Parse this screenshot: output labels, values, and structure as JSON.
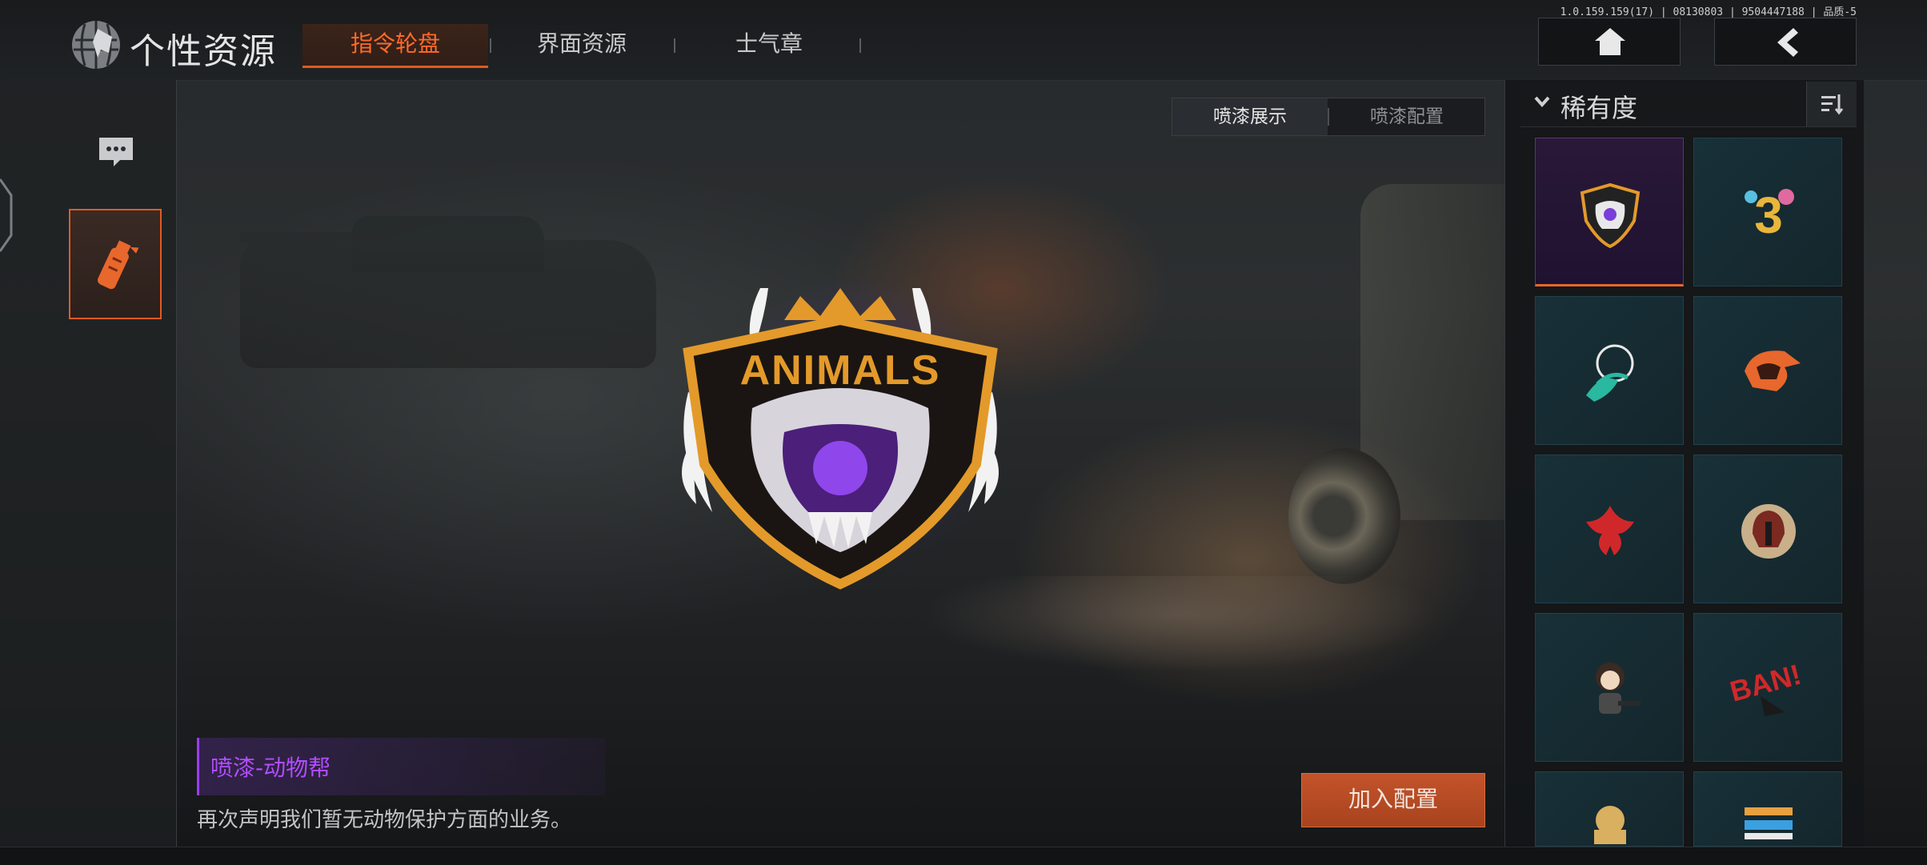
{
  "app": {
    "title": "个性资源",
    "version": "1.0.159.159(17) | 08130803 | 9504447188 | 品质-5"
  },
  "tabs": [
    {
      "label": "指令轮盘",
      "active": true
    },
    {
      "label": "界面资源",
      "active": false
    },
    {
      "label": "士气章",
      "active": false
    }
  ],
  "top_buttons": [
    {
      "icon": "home-icon"
    },
    {
      "icon": "back-arrow-icon"
    }
  ],
  "sidebar": {
    "items": [
      {
        "icon": "chat-bubble-icon",
        "selected": false
      },
      {
        "icon": "spray-grenade-icon",
        "selected": true
      }
    ]
  },
  "view_toggle": {
    "options": [
      "喷漆展示",
      "喷漆配置"
    ],
    "selected": "喷漆展示"
  },
  "selected_item": {
    "name": "喷漆-动物帮",
    "description": "再次声明我们暂无动物保护方面的业务。",
    "emblem_text": "ANIMALS"
  },
  "actions": {
    "add_label": "加入配置"
  },
  "filter": {
    "label": "稀有度",
    "sort_icon": "sort-icon"
  },
  "grid": [
    {
      "icon": "animals-emblem-icon",
      "selected": true
    },
    {
      "icon": "number-three-balloon-icon",
      "selected": false
    },
    {
      "icon": "wraiths-outlaws-icon",
      "selected": false
    },
    {
      "icon": "flaming-helmet-icon",
      "selected": false
    },
    {
      "icon": "red-phoenix-icon",
      "selected": false
    },
    {
      "icon": "spartan-helmet-icon",
      "selected": false
    },
    {
      "icon": "chibi-soldier-icon",
      "selected": false
    },
    {
      "icon": "bang-graffiti-icon",
      "selected": false
    },
    {
      "icon": "golden-figure-icon",
      "selected": false
    },
    {
      "icon": "pixel-logo-icon",
      "selected": false
    }
  ],
  "colors": {
    "accent": "#e05a22",
    "name_purple": "#b14dff",
    "tile_bg": "#183038",
    "selected_tile_bg": "#2a1838"
  }
}
